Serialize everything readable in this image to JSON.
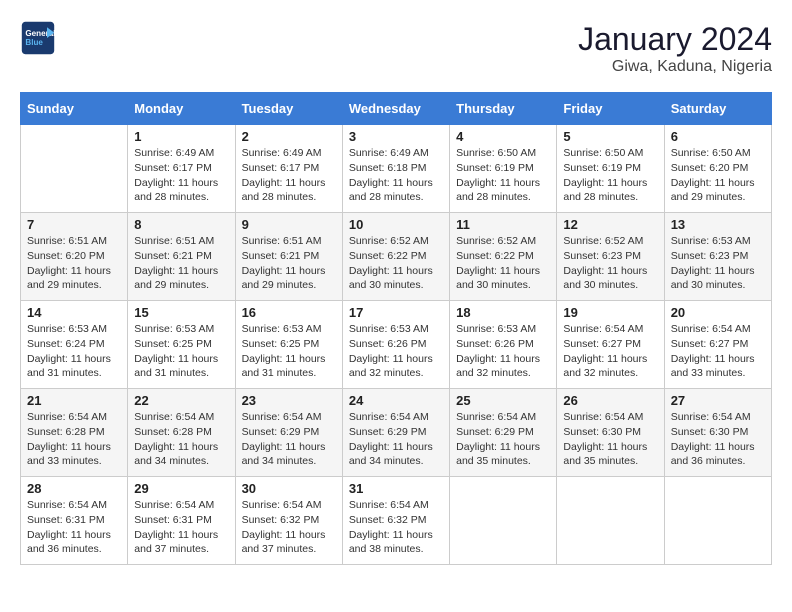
{
  "header": {
    "logo_line1": "General",
    "logo_line2": "Blue",
    "month_year": "January 2024",
    "location": "Giwa, Kaduna, Nigeria"
  },
  "days_of_week": [
    "Sunday",
    "Monday",
    "Tuesday",
    "Wednesday",
    "Thursday",
    "Friday",
    "Saturday"
  ],
  "weeks": [
    [
      {
        "day": "",
        "info": ""
      },
      {
        "day": "1",
        "info": "Sunrise: 6:49 AM\nSunset: 6:17 PM\nDaylight: 11 hours\nand 28 minutes."
      },
      {
        "day": "2",
        "info": "Sunrise: 6:49 AM\nSunset: 6:17 PM\nDaylight: 11 hours\nand 28 minutes."
      },
      {
        "day": "3",
        "info": "Sunrise: 6:49 AM\nSunset: 6:18 PM\nDaylight: 11 hours\nand 28 minutes."
      },
      {
        "day": "4",
        "info": "Sunrise: 6:50 AM\nSunset: 6:19 PM\nDaylight: 11 hours\nand 28 minutes."
      },
      {
        "day": "5",
        "info": "Sunrise: 6:50 AM\nSunset: 6:19 PM\nDaylight: 11 hours\nand 28 minutes."
      },
      {
        "day": "6",
        "info": "Sunrise: 6:50 AM\nSunset: 6:20 PM\nDaylight: 11 hours\nand 29 minutes."
      }
    ],
    [
      {
        "day": "7",
        "info": "Sunrise: 6:51 AM\nSunset: 6:20 PM\nDaylight: 11 hours\nand 29 minutes."
      },
      {
        "day": "8",
        "info": "Sunrise: 6:51 AM\nSunset: 6:21 PM\nDaylight: 11 hours\nand 29 minutes."
      },
      {
        "day": "9",
        "info": "Sunrise: 6:51 AM\nSunset: 6:21 PM\nDaylight: 11 hours\nand 29 minutes."
      },
      {
        "day": "10",
        "info": "Sunrise: 6:52 AM\nSunset: 6:22 PM\nDaylight: 11 hours\nand 30 minutes."
      },
      {
        "day": "11",
        "info": "Sunrise: 6:52 AM\nSunset: 6:22 PM\nDaylight: 11 hours\nand 30 minutes."
      },
      {
        "day": "12",
        "info": "Sunrise: 6:52 AM\nSunset: 6:23 PM\nDaylight: 11 hours\nand 30 minutes."
      },
      {
        "day": "13",
        "info": "Sunrise: 6:53 AM\nSunset: 6:23 PM\nDaylight: 11 hours\nand 30 minutes."
      }
    ],
    [
      {
        "day": "14",
        "info": "Sunrise: 6:53 AM\nSunset: 6:24 PM\nDaylight: 11 hours\nand 31 minutes."
      },
      {
        "day": "15",
        "info": "Sunrise: 6:53 AM\nSunset: 6:25 PM\nDaylight: 11 hours\nand 31 minutes."
      },
      {
        "day": "16",
        "info": "Sunrise: 6:53 AM\nSunset: 6:25 PM\nDaylight: 11 hours\nand 31 minutes."
      },
      {
        "day": "17",
        "info": "Sunrise: 6:53 AM\nSunset: 6:26 PM\nDaylight: 11 hours\nand 32 minutes."
      },
      {
        "day": "18",
        "info": "Sunrise: 6:53 AM\nSunset: 6:26 PM\nDaylight: 11 hours\nand 32 minutes."
      },
      {
        "day": "19",
        "info": "Sunrise: 6:54 AM\nSunset: 6:27 PM\nDaylight: 11 hours\nand 32 minutes."
      },
      {
        "day": "20",
        "info": "Sunrise: 6:54 AM\nSunset: 6:27 PM\nDaylight: 11 hours\nand 33 minutes."
      }
    ],
    [
      {
        "day": "21",
        "info": "Sunrise: 6:54 AM\nSunset: 6:28 PM\nDaylight: 11 hours\nand 33 minutes."
      },
      {
        "day": "22",
        "info": "Sunrise: 6:54 AM\nSunset: 6:28 PM\nDaylight: 11 hours\nand 34 minutes."
      },
      {
        "day": "23",
        "info": "Sunrise: 6:54 AM\nSunset: 6:29 PM\nDaylight: 11 hours\nand 34 minutes."
      },
      {
        "day": "24",
        "info": "Sunrise: 6:54 AM\nSunset: 6:29 PM\nDaylight: 11 hours\nand 34 minutes."
      },
      {
        "day": "25",
        "info": "Sunrise: 6:54 AM\nSunset: 6:29 PM\nDaylight: 11 hours\nand 35 minutes."
      },
      {
        "day": "26",
        "info": "Sunrise: 6:54 AM\nSunset: 6:30 PM\nDaylight: 11 hours\nand 35 minutes."
      },
      {
        "day": "27",
        "info": "Sunrise: 6:54 AM\nSunset: 6:30 PM\nDaylight: 11 hours\nand 36 minutes."
      }
    ],
    [
      {
        "day": "28",
        "info": "Sunrise: 6:54 AM\nSunset: 6:31 PM\nDaylight: 11 hours\nand 36 minutes."
      },
      {
        "day": "29",
        "info": "Sunrise: 6:54 AM\nSunset: 6:31 PM\nDaylight: 11 hours\nand 37 minutes."
      },
      {
        "day": "30",
        "info": "Sunrise: 6:54 AM\nSunset: 6:32 PM\nDaylight: 11 hours\nand 37 minutes."
      },
      {
        "day": "31",
        "info": "Sunrise: 6:54 AM\nSunset: 6:32 PM\nDaylight: 11 hours\nand 38 minutes."
      },
      {
        "day": "",
        "info": ""
      },
      {
        "day": "",
        "info": ""
      },
      {
        "day": "",
        "info": ""
      }
    ]
  ]
}
